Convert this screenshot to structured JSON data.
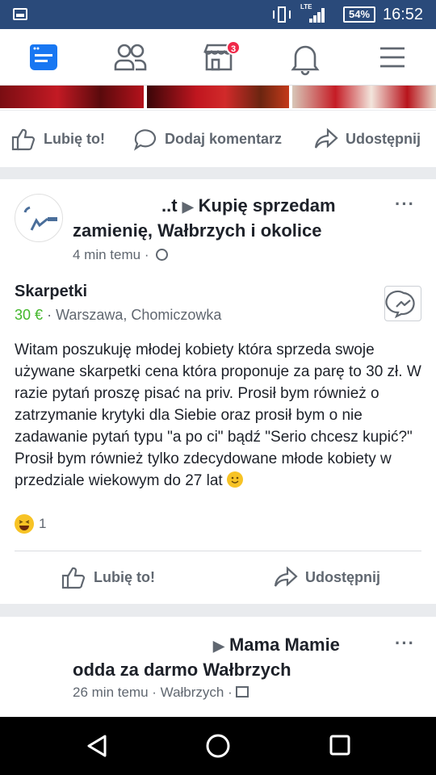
{
  "status_bar": {
    "network": "LTE",
    "battery": "54%",
    "time": "16:52"
  },
  "nav": {
    "icons": [
      "news-feed-icon",
      "friends-icon",
      "marketplace-icon",
      "notifications-icon",
      "menu-icon"
    ],
    "marketplace_badge": "3",
    "accent": "#3b5998"
  },
  "prev_post_actions": {
    "like": "Lubię to!",
    "comment": "Dodaj komentarz",
    "share": "Udostępnij"
  },
  "post": {
    "author_fragment": "..t",
    "group": "Kupię sprzedam zamienię, Wałbrzych i okolice",
    "time": "4 min temu",
    "more": "···",
    "item_title": "Skarpetki",
    "price": "30 €",
    "location": "Warszawa, Chomiczowka",
    "body": "Witam poszukuję młodej kobiety która sprzeda swoje używane skarpetki cena która proponuje za parę to 30 zł. W razie pytań proszę pisać na priv. Prosił bym również o zatrzymanie krytyki dla Siebie oraz prosił bym o nie zadawanie pytań typu \"a po ci\" bądź \"Serio chcesz kupić?\" Prosił bym również tylko zdecydowane młode kobiety w przedziale wiekowym do 27 lat",
    "reaction_count": "1",
    "actions": {
      "like": "Lubię to!",
      "share": "Udostępnij"
    }
  },
  "next_post": {
    "group": "Mama Mamie odda za darmo Wałbrzych",
    "time": "26 min temu",
    "location": "Wałbrzych",
    "more": "···"
  }
}
